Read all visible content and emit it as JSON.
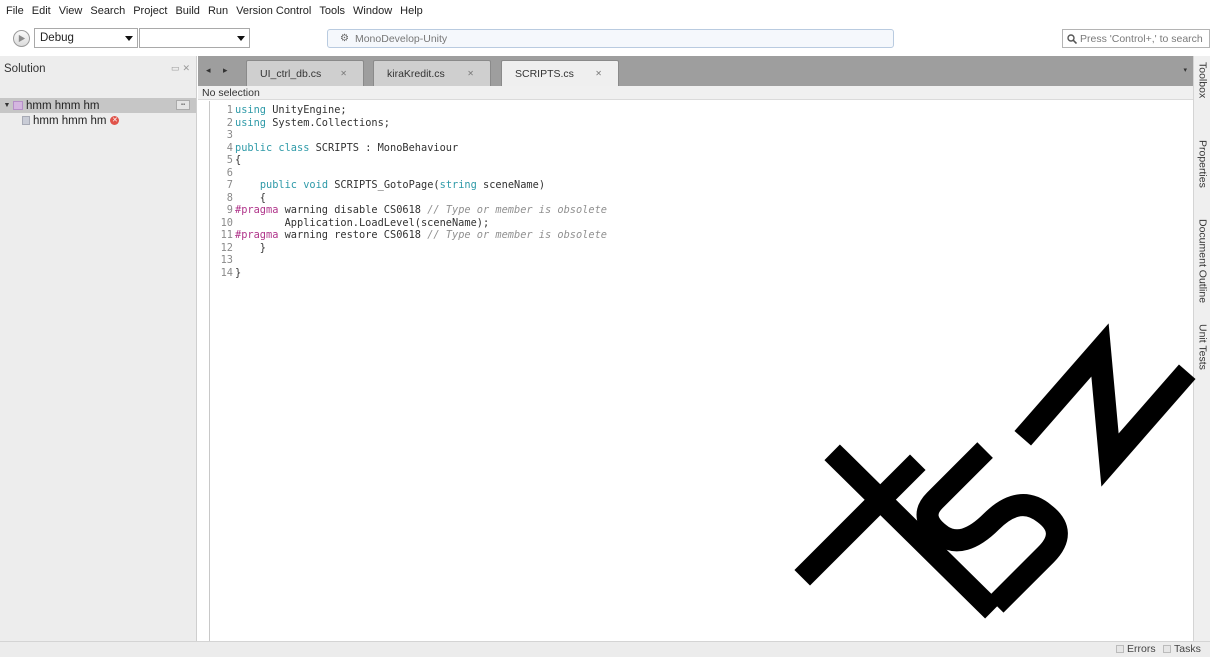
{
  "menu": [
    "File",
    "Edit",
    "View",
    "Search",
    "Project",
    "Build",
    "Run",
    "Version Control",
    "Tools",
    "Window",
    "Help"
  ],
  "toolbar": {
    "config": "Debug",
    "target": "",
    "status": "MonoDevelop-Unity",
    "search_placeholder": "Press 'Control+,' to search"
  },
  "solution": {
    "title": "Solution",
    "solution_name": "hmm hmm hm",
    "project_name": "hmm hmm hm"
  },
  "tabs": [
    {
      "label": "UI_ctrl_db.cs"
    },
    {
      "label": "kiraKredit.cs"
    },
    {
      "label": "SCRIPTS.cs"
    }
  ],
  "navbar": "No selection",
  "code_lines": [
    {
      "n": "1",
      "seg": [
        {
          "t": "using",
          "c": "kw"
        },
        {
          "t": " UnityEngine;",
          "c": "ct"
        }
      ]
    },
    {
      "n": "2",
      "seg": [
        {
          "t": "using",
          "c": "kw"
        },
        {
          "t": " System.Collections;",
          "c": "ct"
        }
      ]
    },
    {
      "n": "3",
      "seg": []
    },
    {
      "n": "4",
      "seg": [
        {
          "t": "public",
          "c": "kw"
        },
        {
          "t": " ",
          "c": "ct"
        },
        {
          "t": "class",
          "c": "kw"
        },
        {
          "t": " SCRIPTS : MonoBehaviour",
          "c": "ct"
        }
      ]
    },
    {
      "n": "5",
      "seg": [
        {
          "t": "{",
          "c": "ct"
        }
      ]
    },
    {
      "n": "6",
      "seg": []
    },
    {
      "n": "7",
      "seg": [
        {
          "t": "    ",
          "c": "ct"
        },
        {
          "t": "public",
          "c": "kw"
        },
        {
          "t": " ",
          "c": "ct"
        },
        {
          "t": "void",
          "c": "kw"
        },
        {
          "t": " SCRIPTS_GotoPage(",
          "c": "ct"
        },
        {
          "t": "string",
          "c": "kw"
        },
        {
          "t": " sceneName)",
          "c": "ct"
        }
      ]
    },
    {
      "n": "8",
      "seg": [
        {
          "t": "    {",
          "c": "ct"
        }
      ]
    },
    {
      "n": "9",
      "seg": [
        {
          "t": "#pragma",
          "c": "pp"
        },
        {
          "t": " warning disable CS0618 ",
          "c": "ct"
        },
        {
          "t": "// Type or member is obsolete",
          "c": "cm"
        }
      ]
    },
    {
      "n": "10",
      "seg": [
        {
          "t": "        Application.LoadLevel(sceneName);",
          "c": "ct"
        }
      ]
    },
    {
      "n": "11",
      "seg": [
        {
          "t": "#pragma",
          "c": "pp"
        },
        {
          "t": " warning restore CS0618 ",
          "c": "ct"
        },
        {
          "t": "// Type or member is obsolete",
          "c": "cm"
        }
      ]
    },
    {
      "n": "12",
      "seg": [
        {
          "t": "    }",
          "c": "ct"
        }
      ]
    },
    {
      "n": "13",
      "seg": []
    },
    {
      "n": "14",
      "seg": [
        {
          "t": "}",
          "c": "ct"
        }
      ]
    }
  ],
  "dock": [
    "Toolbox",
    "Properties",
    "Document Outline",
    "Unit Tests"
  ],
  "status": {
    "errors": "Errors",
    "tasks": "Tasks"
  },
  "colors": {
    "keyword": "#2e9aa8",
    "preprocessor": "#b0348a",
    "comment": "#909090",
    "tabbar": "#9e9e9e"
  },
  "icons": [
    "run-icon",
    "dropdown-arrow-icon",
    "gear-icon",
    "search-icon",
    "expand-icon",
    "solution-icon",
    "csharp-file-icon",
    "error-icon",
    "close-icon",
    "nav-left-icon",
    "nav-right-icon"
  ],
  "watermark": "TSM"
}
